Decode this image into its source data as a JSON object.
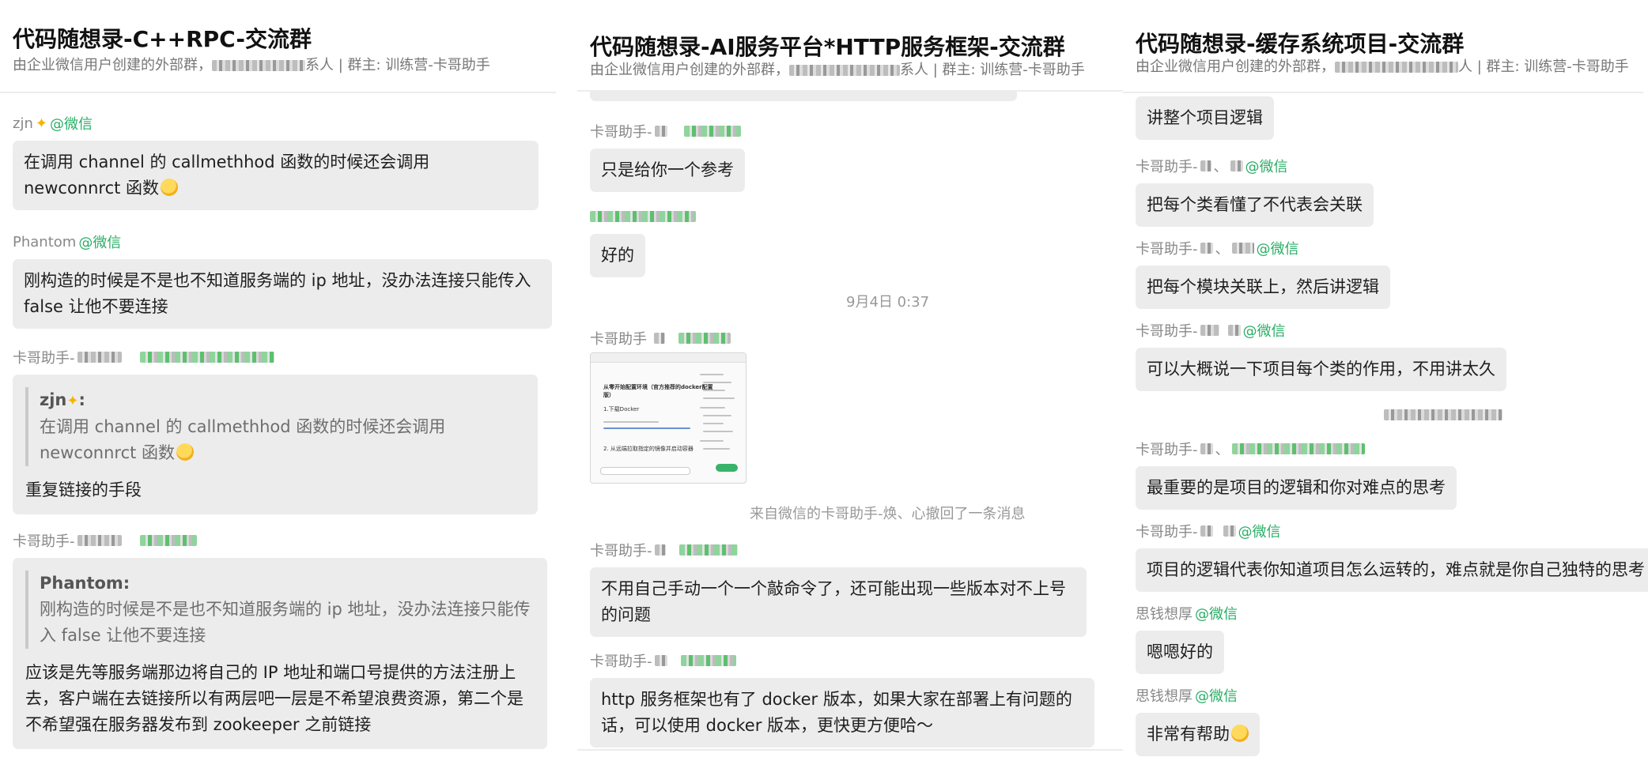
{
  "panels": [
    {
      "title": "代码随想录-C++RPC-交流群",
      "subtitle_prefix": "由企业微信用户创建的外部群，",
      "subtitle_suffix": "系人 | 群主: 训练营-卡哥助手",
      "messages": [
        {
          "sender": "zjn",
          "via": "@微信",
          "text": "在调用 channel 的 callmethhod 函数的时候还会调用 newconnrct 函数"
        },
        {
          "sender": "Phantom",
          "via": "@微信",
          "text": "刚构造的时候是不是也不知道服务端的 ip 地址，没办法连接只能传入 false 让他不要连接"
        },
        {
          "sender": "卡哥助手-",
          "quote_name": "zjn",
          "quote_text": "在调用 channel 的 callmethhod 函数的时候还会调用 newconnrct 函数",
          "text": "重复链接的手段"
        },
        {
          "sender": "卡哥助手-",
          "quote_name": "Phantom:",
          "quote_text": "刚构造的时候是不是也不知道服务端的 ip 地址，没办法连接只能传入 false 让他不要连接",
          "text": "应该是先等服务端那边将自己的 IP 地址和端口号提供的方法注册上去，客户端在去链接所以有两层吧一层是不希望浪费资源，第二个是不希望强在服务器发布到 zookeeper 之前链接"
        }
      ]
    },
    {
      "title": "代码随想录-AI服务平台*HTTP服务框架-交流群",
      "subtitle_prefix": "由企业微信用户创建的外部群，",
      "subtitle_suffix": "系人 | 群主: 训练营-卡哥助手",
      "messages": [
        {
          "sender": "卡哥助手-",
          "text": "只是给你一个参考"
        },
        {
          "sender": "",
          "text": "好的"
        },
        {
          "sender": "卡哥助手",
          "text": ""
        },
        {
          "sender": "卡哥助手-",
          "text": "不用自己手动一个一个敲命令了，还可能出现一些版本对不上号的问题"
        },
        {
          "sender": "卡哥助手-",
          "text": "http 服务框架也有了 docker 版本，如果大家在部署上有问题的话，可以使用 docker 版本，更快更方便哈～"
        }
      ],
      "timestamp": "9月4日 0:37",
      "recall_notice": "来自微信的卡哥助手-焕、心撤回了一条消息",
      "image_doc": {
        "heading": "从零开始配置环境（官方推荐的docker配置版）",
        "step1": "1.下载Docker",
        "step2": "2. 从远端拉取指定的镜像并启动容器"
      }
    },
    {
      "title": "代码随想录-缓存系统项目-交流群",
      "subtitle_prefix": "由企业微信用户创建的外部群，",
      "subtitle_suffix": "人 | 群主: 训练营-卡哥助手",
      "messages": [
        {
          "sender": "",
          "text": "讲整个项目逻辑"
        },
        {
          "sender": "卡哥助手-",
          "via": "@微信",
          "text": "把每个类看懂了不代表会关联"
        },
        {
          "sender": "卡哥助手-",
          "via": "@微信",
          "text": "把每个模块关联上，然后讲逻辑"
        },
        {
          "sender": "卡哥助手-",
          "via": "@微信",
          "text": "可以大概说一下项目每个类的作用，不用讲太久"
        },
        {
          "sender": "卡哥助手-",
          "via": "",
          "text": "最重要的是项目的逻辑和你对难点的思考"
        },
        {
          "sender": "卡哥助手-",
          "via": "@微信",
          "text": "项目的逻辑代表你知道项目怎么运转的，难点就是你自己独特的思考"
        },
        {
          "sender": "思钱想厚",
          "via": "@微信",
          "text": "嗯嗯好的"
        },
        {
          "sender": "思钱想厚",
          "via": "@微信",
          "text": "非常有帮助"
        }
      ]
    }
  ],
  "colors": {
    "wechat_green": "#2aae67",
    "bubble": "#ececec",
    "meta": "#888888"
  }
}
